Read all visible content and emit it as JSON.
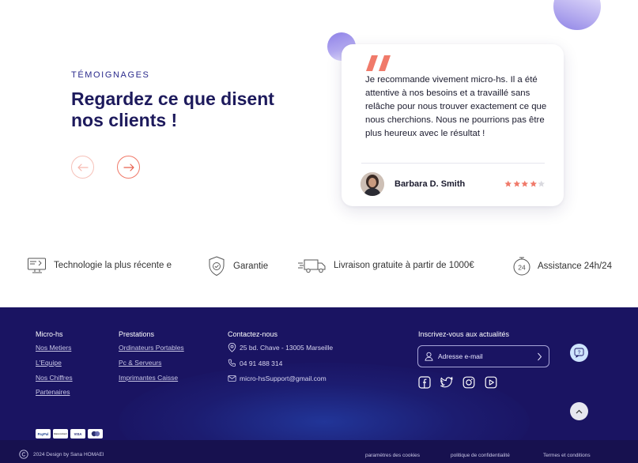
{
  "testimonials": {
    "eyebrow": "TÉMOIGNAGES",
    "headline": "Regardez ce que disent nos clients !",
    "prev_label": "←",
    "next_label": "→",
    "card": {
      "quote": "Je recommande vivement micro-hs. Il a été attentive à nos besoins et a travaillé sans relâche pour nous trouver exactement ce que nous cherchions. Nous ne pourrions pas être plus heureux avec le résultat !",
      "author": "Barbara D. Smith",
      "rating": 4,
      "rating_max": 5
    }
  },
  "features": [
    {
      "icon": "monitor-icon",
      "label": "Technologie la plus récente e"
    },
    {
      "icon": "shield-check-icon",
      "label": "Garantie"
    },
    {
      "icon": "delivery-truck-icon",
      "label": "Livraison gratuite à partir de 1000€"
    },
    {
      "icon": "support-24h-icon",
      "label": "Assistance 24h/24"
    }
  ],
  "footer": {
    "col1": {
      "title": "Micro-hs",
      "links": [
        "Nos Metiers",
        "L'Equipe",
        "Nos Chiffres",
        "Partenaires"
      ]
    },
    "col2": {
      "title": "Prestations",
      "links": [
        "Ordinateurs Portables",
        "Pc & Serveurs",
        "Imprimantes Caisse"
      ]
    },
    "contact": {
      "title": "Contactez-nous",
      "address": "25 bd. Chave - 13005 Marseille",
      "phone": "04 91 488 314",
      "email": "micro-hsSupport@gmail.com"
    },
    "newsletter": {
      "title": "Inscrivez-vous aux actualités",
      "placeholder": "Adresse e-mail"
    },
    "socials": [
      "facebook-icon",
      "twitter-icon",
      "instagram-icon",
      "youtube-icon"
    ],
    "payments": [
      "PayPal",
      "Bancontact",
      "VISA",
      "Mastercard"
    ],
    "copyright": "2024 Design by Sana HOMAEI",
    "legal": [
      "paramètres des cookies",
      "politique de confidentialité",
      "Termes et conditions"
    ]
  },
  "colors": {
    "accent": "#f07a6a",
    "brand_navy": "#1d1a5c",
    "footer_bg": "#1a1462",
    "star": "#f07a6a",
    "star_empty": "#d9d9df"
  }
}
